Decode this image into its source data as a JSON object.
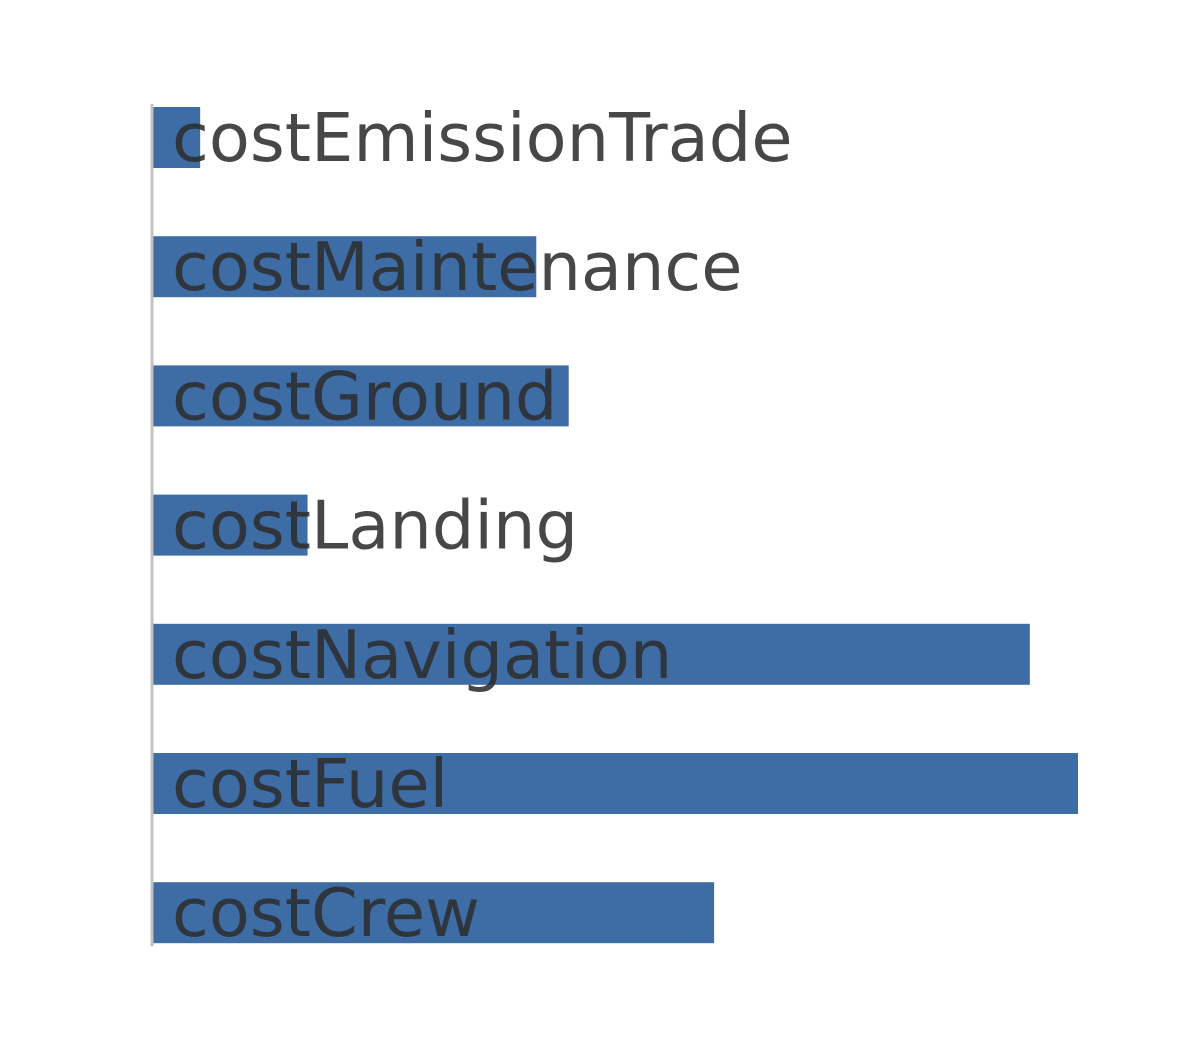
{
  "chart_data": {
    "type": "bar",
    "orientation": "horizontal",
    "title": "",
    "xlabel": "",
    "ylabel": "",
    "xlim": [
      0,
      100
    ],
    "grid": false,
    "legend": "none",
    "bar_color": "#3e6ca5",
    "label_color": "#2e2e2e",
    "axis_color": "#c0c0c0",
    "categories": [
      "costEmissionTrade",
      "costMaintenance",
      "costGround",
      "costLanding",
      "costNavigation",
      "costFuel",
      "costCrew"
    ],
    "values": [
      5.2,
      41.5,
      45,
      16.8,
      94.8,
      100,
      60.7
    ]
  }
}
